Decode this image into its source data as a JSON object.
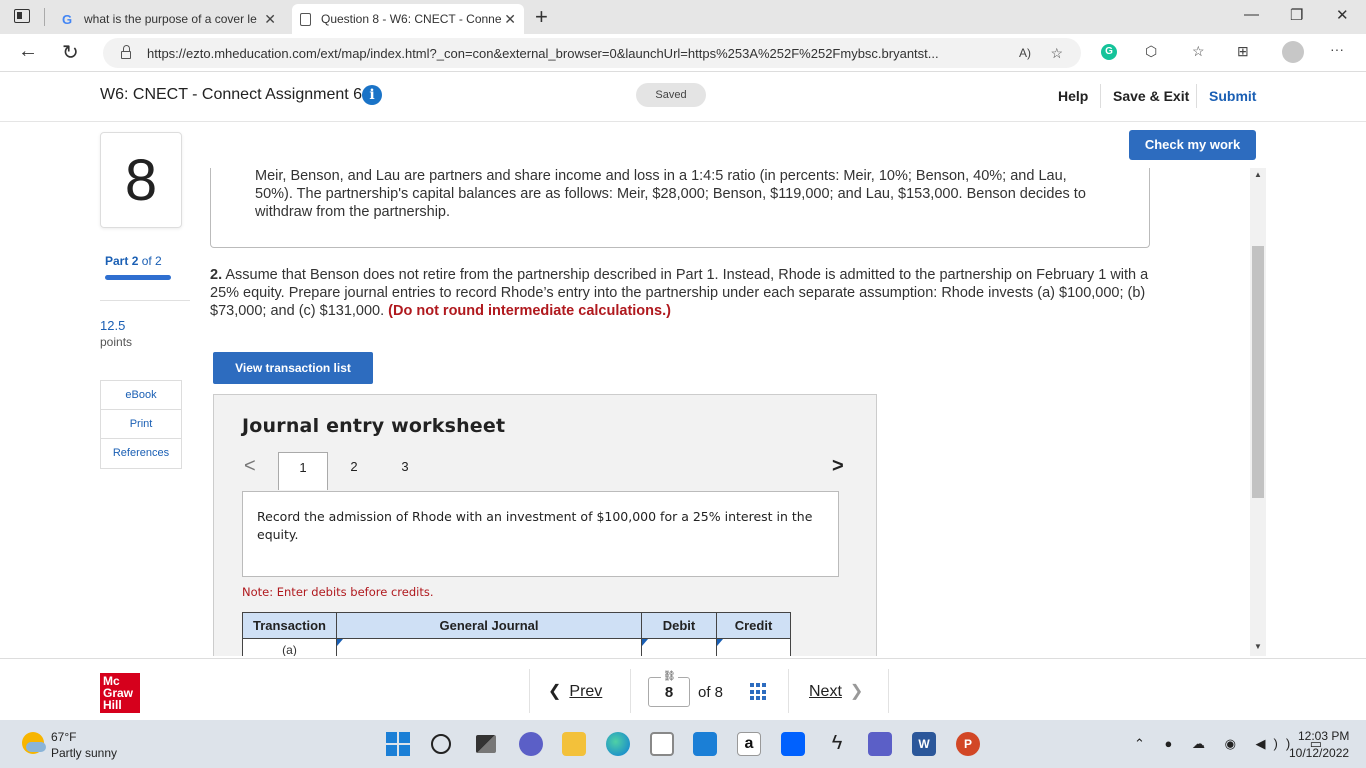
{
  "browser": {
    "tabs": [
      {
        "label": "what is the purpose of a cover le",
        "active": false
      },
      {
        "label": "Question 8 - W6: CNECT - Conne",
        "active": true
      }
    ],
    "new_tab": "+",
    "close_glyph": "✕",
    "url": "https://ezto.mheducation.com/ext/map/index.html?_con=con&external_browser=0&launchUrl=https%253A%252F%252Fmybsc.bryantst...",
    "read_aloud": "A)",
    "window_controls": {
      "minimize": "—",
      "maximize": "❐",
      "close": "✕"
    }
  },
  "header": {
    "title": "W6: CNECT - Connect Assignment 6",
    "info": "i",
    "saved": "Saved",
    "help": "Help",
    "save_exit": "Save & Exit",
    "submit": "Submit"
  },
  "sidebar": {
    "question_number": "8",
    "part_prefix": "Part",
    "part_current": "2",
    "part_suffix": "of 2",
    "part_progress": 1.0,
    "points_value": "12.5",
    "points_label": "points",
    "resources": [
      "eBook",
      "Print",
      "References"
    ]
  },
  "main": {
    "check_work": "Check my work",
    "context": "Meir, Benson, and Lau are partners and share income and loss in a 1:4:5 ratio (in percents: Meir, 10%; Benson, 40%; and Lau, 50%). The partnership's capital balances are as follows: Meir, $28,000; Benson, $119,000; and Lau, $153,000. Benson decides to withdraw from the partnership.",
    "question_number_label": "2.",
    "question_text": "Assume that Benson does not retire from the partnership described in Part 1. Instead, Rhode is admitted to the partnership on February 1 with a 25% equity. Prepare journal entries to record Rhode’s entry into the partnership under each separate assumption: Rhode invests (a) $100,000; (b) $73,000; and (c) $131,000.",
    "question_warning": "(Do not round intermediate calculations.)",
    "view_transactions": "View transaction list"
  },
  "worksheet": {
    "title": "Journal entry worksheet",
    "tabs": [
      "1",
      "2",
      "3"
    ],
    "active_tab": "1",
    "instruction": "Record the admission of Rhode with an investment of $100,000 for a 25% interest in the equity.",
    "note": "Note: Enter debits before credits.",
    "columns": [
      "Transaction",
      "General Journal",
      "Debit",
      "Credit"
    ],
    "rows": [
      {
        "transaction": "(a)",
        "account": "",
        "debit": "",
        "credit": ""
      }
    ]
  },
  "footer": {
    "logo_lines": [
      "Mc",
      "Graw",
      "Hill"
    ],
    "prev": "Prev",
    "current_page": "8",
    "of_total": "of  8",
    "next": "Next"
  },
  "taskbar": {
    "temperature": "67°F",
    "weather": "Partly sunny",
    "amazon_glyph": "a",
    "word_glyph": "W",
    "ppt_glyph": "P",
    "time": "12:03 PM",
    "date": "10/12/2022"
  }
}
